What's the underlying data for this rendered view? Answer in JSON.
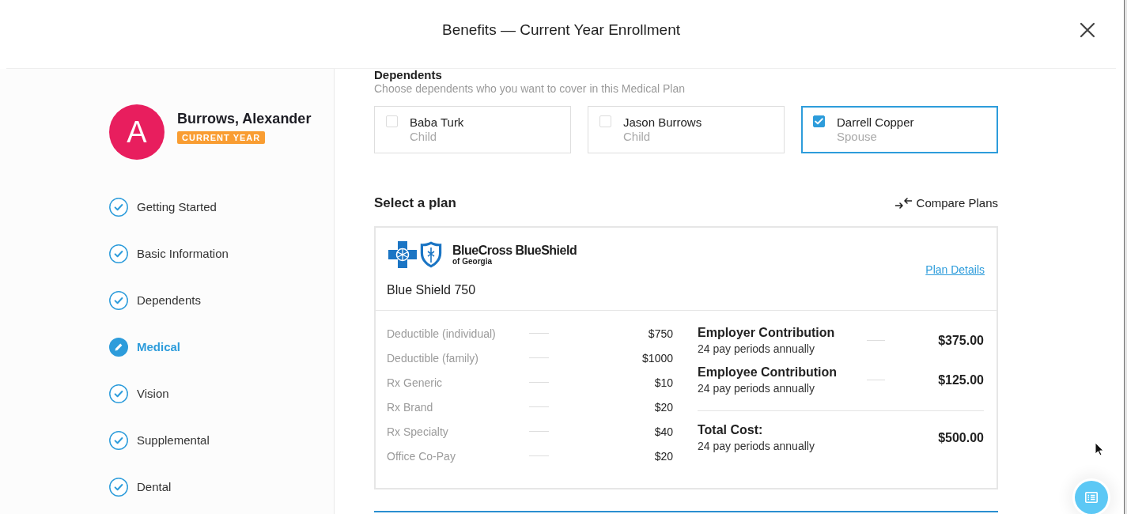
{
  "window": {
    "title": "Benefits — Current Year Enrollment"
  },
  "profile": {
    "initial": "A",
    "name": "Burrows, Alexander",
    "badge": "CURRENT YEAR"
  },
  "steps": [
    {
      "label": "Getting Started",
      "kind": "done",
      "selected": false
    },
    {
      "label": "Basic Information",
      "kind": "done",
      "selected": false
    },
    {
      "label": "Dependents",
      "kind": "done",
      "selected": false
    },
    {
      "label": "Medical",
      "kind": "editing",
      "selected": true
    },
    {
      "label": "Vision",
      "kind": "done",
      "selected": false
    },
    {
      "label": "Supplemental",
      "kind": "done",
      "selected": false
    },
    {
      "label": "Dental",
      "kind": "done",
      "selected": false
    }
  ],
  "dependents": {
    "title": "Dependents",
    "subtitle": "Choose dependents who you want to cover in this Medical Plan",
    "items": [
      {
        "name": "Baba Turk",
        "relation": "Child",
        "checked": false
      },
      {
        "name": "Jason Burrows",
        "relation": "Child",
        "checked": false
      },
      {
        "name": "Darrell Copper",
        "relation": "Spouse",
        "checked": true
      }
    ]
  },
  "plan_picker": {
    "title": "Select a plan",
    "compare_button": "Compare Plans"
  },
  "plan": {
    "carrier": {
      "name": "BlueCross BlueShield",
      "region": "of Georgia"
    },
    "details_link": "Plan Details",
    "name": "Blue Shield 750",
    "benefits": [
      {
        "label": "Deductible (individual)",
        "value": "$750"
      },
      {
        "label": "Deductible (family)",
        "value": "$1000"
      },
      {
        "label": "Rx Generic",
        "value": "$10"
      },
      {
        "label": "Rx Brand",
        "value": "$20"
      },
      {
        "label": "Rx Specialty",
        "value": "$40"
      },
      {
        "label": "Office Co-Pay",
        "value": "$20"
      }
    ],
    "contributions": [
      {
        "label": "Employer Contribution",
        "note": "24 pay periods annually",
        "amount": "$375.00"
      },
      {
        "label": "Employee Contribution",
        "note": "24 pay periods annually",
        "amount": "$125.00"
      }
    ],
    "total": {
      "label": "Total Cost:",
      "note": "24 pay periods annually",
      "amount": "$500.00"
    }
  }
}
